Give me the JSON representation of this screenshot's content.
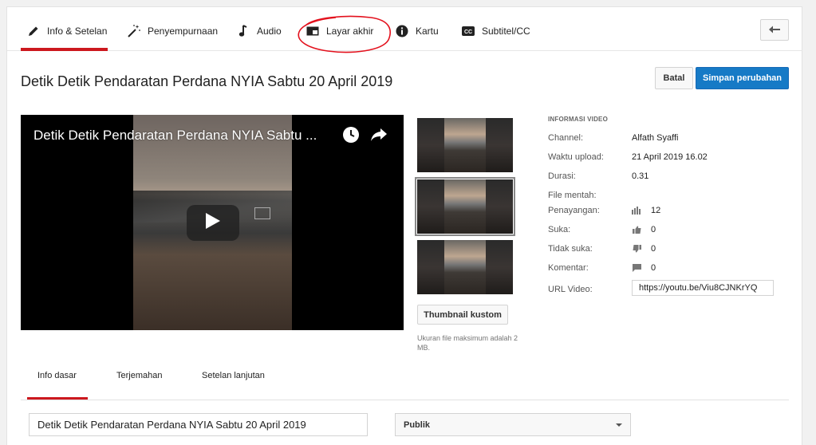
{
  "tabs": [
    {
      "label": "Info & Setelan",
      "icon": "pencil-icon"
    },
    {
      "label": "Penyempurnaan",
      "icon": "magic-wand-icon"
    },
    {
      "label": "Audio",
      "icon": "music-note-icon"
    },
    {
      "label": "Layar akhir",
      "icon": "end-screen-icon"
    },
    {
      "label": "Kartu",
      "icon": "info-icon"
    },
    {
      "label": "Subtitel/CC",
      "icon": "cc-icon"
    }
  ],
  "header": {
    "title": "Detik Detik Pendaratan Perdana NYIA Sabtu 20 April 2019",
    "cancel_label": "Batal",
    "save_label": "Simpan perubahan"
  },
  "player": {
    "title": "Detik Detik Pendaratan Perdana NYIA Sabtu ..."
  },
  "thumbnails": {
    "custom_button": "Thumbnail kustom",
    "note": "Ukuran file maksimum adalah 2 MB."
  },
  "video_info": {
    "heading": "INFORMASI VIDEO",
    "channel_label": "Channel:",
    "channel_value": "Alfath Syaffi",
    "upload_label": "Waktu upload:",
    "upload_value": "21 April 2019 16.02",
    "duration_label": "Durasi:",
    "duration_value": "0.31",
    "raw_file_label": "File mentah:",
    "views_label": "Penayangan:",
    "views_value": "12",
    "likes_label": "Suka:",
    "likes_value": "0",
    "dislikes_label": "Tidak suka:",
    "dislikes_value": "0",
    "comments_label": "Komentar:",
    "comments_value": "0",
    "url_label": "URL Video:",
    "url_value": "https://youtu.be/Viu8CJNKrYQ"
  },
  "sub_tabs": [
    "Info dasar",
    "Terjemahan",
    "Setelan lanjutan"
  ],
  "form": {
    "title_value": "Detik Detik Pendaratan Perdana NYIA Sabtu 20 April 2019",
    "privacy_value": "Publik"
  },
  "colors": {
    "accent_red": "#cc181e",
    "primary_blue": "#167ac6"
  }
}
